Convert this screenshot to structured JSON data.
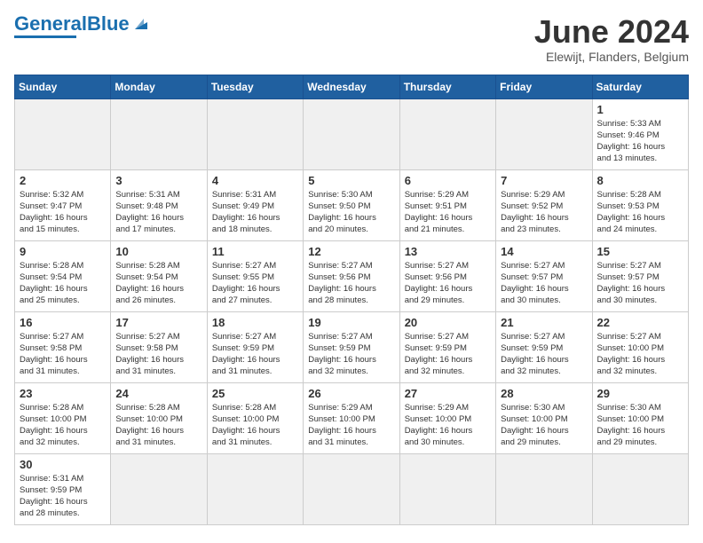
{
  "header": {
    "logo_general": "General",
    "logo_blue": "Blue",
    "month_title": "June 2024",
    "location": "Elewijt, Flanders, Belgium"
  },
  "days_of_week": [
    "Sunday",
    "Monday",
    "Tuesday",
    "Wednesday",
    "Thursday",
    "Friday",
    "Saturday"
  ],
  "weeks": [
    [
      {
        "day": "",
        "info": ""
      },
      {
        "day": "",
        "info": ""
      },
      {
        "day": "",
        "info": ""
      },
      {
        "day": "",
        "info": ""
      },
      {
        "day": "",
        "info": ""
      },
      {
        "day": "",
        "info": ""
      },
      {
        "day": "1",
        "info": "Sunrise: 5:33 AM\nSunset: 9:46 PM\nDaylight: 16 hours\nand 13 minutes."
      }
    ],
    [
      {
        "day": "2",
        "info": "Sunrise: 5:32 AM\nSunset: 9:47 PM\nDaylight: 16 hours\nand 15 minutes."
      },
      {
        "day": "3",
        "info": "Sunrise: 5:31 AM\nSunset: 9:48 PM\nDaylight: 16 hours\nand 17 minutes."
      },
      {
        "day": "4",
        "info": "Sunrise: 5:31 AM\nSunset: 9:49 PM\nDaylight: 16 hours\nand 18 minutes."
      },
      {
        "day": "5",
        "info": "Sunrise: 5:30 AM\nSunset: 9:50 PM\nDaylight: 16 hours\nand 20 minutes."
      },
      {
        "day": "6",
        "info": "Sunrise: 5:29 AM\nSunset: 9:51 PM\nDaylight: 16 hours\nand 21 minutes."
      },
      {
        "day": "7",
        "info": "Sunrise: 5:29 AM\nSunset: 9:52 PM\nDaylight: 16 hours\nand 23 minutes."
      },
      {
        "day": "8",
        "info": "Sunrise: 5:28 AM\nSunset: 9:53 PM\nDaylight: 16 hours\nand 24 minutes."
      }
    ],
    [
      {
        "day": "9",
        "info": "Sunrise: 5:28 AM\nSunset: 9:54 PM\nDaylight: 16 hours\nand 25 minutes."
      },
      {
        "day": "10",
        "info": "Sunrise: 5:28 AM\nSunset: 9:54 PM\nDaylight: 16 hours\nand 26 minutes."
      },
      {
        "day": "11",
        "info": "Sunrise: 5:27 AM\nSunset: 9:55 PM\nDaylight: 16 hours\nand 27 minutes."
      },
      {
        "day": "12",
        "info": "Sunrise: 5:27 AM\nSunset: 9:56 PM\nDaylight: 16 hours\nand 28 minutes."
      },
      {
        "day": "13",
        "info": "Sunrise: 5:27 AM\nSunset: 9:56 PM\nDaylight: 16 hours\nand 29 minutes."
      },
      {
        "day": "14",
        "info": "Sunrise: 5:27 AM\nSunset: 9:57 PM\nDaylight: 16 hours\nand 30 minutes."
      },
      {
        "day": "15",
        "info": "Sunrise: 5:27 AM\nSunset: 9:57 PM\nDaylight: 16 hours\nand 30 minutes."
      }
    ],
    [
      {
        "day": "16",
        "info": "Sunrise: 5:27 AM\nSunset: 9:58 PM\nDaylight: 16 hours\nand 31 minutes."
      },
      {
        "day": "17",
        "info": "Sunrise: 5:27 AM\nSunset: 9:58 PM\nDaylight: 16 hours\nand 31 minutes."
      },
      {
        "day": "18",
        "info": "Sunrise: 5:27 AM\nSunset: 9:59 PM\nDaylight: 16 hours\nand 31 minutes."
      },
      {
        "day": "19",
        "info": "Sunrise: 5:27 AM\nSunset: 9:59 PM\nDaylight: 16 hours\nand 32 minutes."
      },
      {
        "day": "20",
        "info": "Sunrise: 5:27 AM\nSunset: 9:59 PM\nDaylight: 16 hours\nand 32 minutes."
      },
      {
        "day": "21",
        "info": "Sunrise: 5:27 AM\nSunset: 9:59 PM\nDaylight: 16 hours\nand 32 minutes."
      },
      {
        "day": "22",
        "info": "Sunrise: 5:27 AM\nSunset: 10:00 PM\nDaylight: 16 hours\nand 32 minutes."
      }
    ],
    [
      {
        "day": "23",
        "info": "Sunrise: 5:28 AM\nSunset: 10:00 PM\nDaylight: 16 hours\nand 32 minutes."
      },
      {
        "day": "24",
        "info": "Sunrise: 5:28 AM\nSunset: 10:00 PM\nDaylight: 16 hours\nand 31 minutes."
      },
      {
        "day": "25",
        "info": "Sunrise: 5:28 AM\nSunset: 10:00 PM\nDaylight: 16 hours\nand 31 minutes."
      },
      {
        "day": "26",
        "info": "Sunrise: 5:29 AM\nSunset: 10:00 PM\nDaylight: 16 hours\nand 31 minutes."
      },
      {
        "day": "27",
        "info": "Sunrise: 5:29 AM\nSunset: 10:00 PM\nDaylight: 16 hours\nand 30 minutes."
      },
      {
        "day": "28",
        "info": "Sunrise: 5:30 AM\nSunset: 10:00 PM\nDaylight: 16 hours\nand 29 minutes."
      },
      {
        "day": "29",
        "info": "Sunrise: 5:30 AM\nSunset: 10:00 PM\nDaylight: 16 hours\nand 29 minutes."
      }
    ],
    [
      {
        "day": "30",
        "info": "Sunrise: 5:31 AM\nSunset: 9:59 PM\nDaylight: 16 hours\nand 28 minutes."
      },
      {
        "day": "",
        "info": ""
      },
      {
        "day": "",
        "info": ""
      },
      {
        "day": "",
        "info": ""
      },
      {
        "day": "",
        "info": ""
      },
      {
        "day": "",
        "info": ""
      },
      {
        "day": "",
        "info": ""
      }
    ]
  ]
}
